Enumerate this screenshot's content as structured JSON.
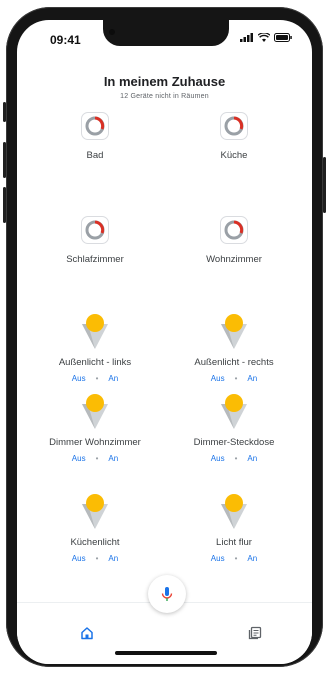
{
  "status": {
    "time": "09:41"
  },
  "header": {
    "title": "In meinem Zuhause",
    "subtitle": "12 Geräte nicht in Räumen"
  },
  "thermostats": [
    {
      "label": "Bad"
    },
    {
      "label": "Küche"
    },
    {
      "label": "Schlafzimmer"
    },
    {
      "label": "Wohnzimmer"
    }
  ],
  "lights": [
    {
      "label": "Außenlicht - links",
      "off": "Aus",
      "on": "An"
    },
    {
      "label": "Außenlicht - rechts",
      "off": "Aus",
      "on": "An"
    },
    {
      "label": "Dimmer Wohnzimmer",
      "off": "Aus",
      "on": "An"
    },
    {
      "label": "Dimmer-Steckdose",
      "off": "Aus",
      "on": "An"
    },
    {
      "label": "Küchenlicht",
      "off": "Aus",
      "on": "An"
    },
    {
      "label": "Licht flur",
      "off": "Aus",
      "on": "An"
    }
  ],
  "nav": {
    "items": [
      {
        "icon": "home-icon"
      },
      {
        "icon": "feed-icon"
      }
    ]
  },
  "fab": {
    "icon": "microphone-icon"
  },
  "colors": {
    "accent": "#1a73e8",
    "thermostat": "#d93025",
    "bulb": "#fbbc04"
  }
}
